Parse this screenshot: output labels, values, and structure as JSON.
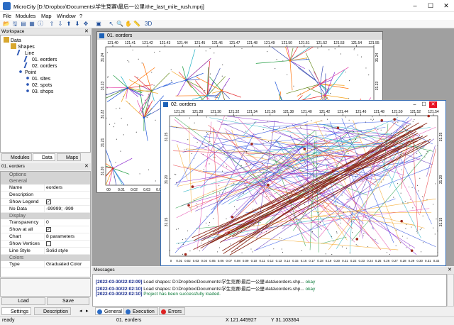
{
  "window": {
    "title": "MicroCity [D:\\Dropbox\\Documents\\学生竞赛\\最后一公里\\the_last_mile_rush.mprj]",
    "controls": [
      "–",
      "☐",
      "✕"
    ]
  },
  "menu": [
    "File",
    "Modules",
    "Map",
    "Window",
    "?"
  ],
  "toolbar": [
    {
      "name": "open-icon",
      "glyph": "📂"
    },
    {
      "name": "save-icon",
      "glyph": "🖫"
    },
    {
      "name": "table-icon",
      "glyph": "▤"
    },
    {
      "name": "properties-icon",
      "glyph": "▦"
    },
    {
      "name": "info-icon",
      "glyph": "ⓘ"
    },
    {
      "name": "arrow-up-icon",
      "glyph": "⇧"
    },
    {
      "name": "arrow-down-icon",
      "glyph": "⇩"
    },
    {
      "name": "layer-up-icon",
      "glyph": "⬆"
    },
    {
      "name": "layer-down-icon",
      "glyph": "⬇"
    },
    {
      "name": "move-icon",
      "glyph": "✥"
    },
    {
      "name": "zoom-box-icon",
      "glyph": "▣"
    },
    {
      "name": "select-icon",
      "glyph": "↖"
    },
    {
      "name": "zoom-icon",
      "glyph": "🔍"
    },
    {
      "name": "pan-icon",
      "glyph": "✋"
    },
    {
      "name": "measure-icon",
      "glyph": "📏"
    },
    {
      "name": "3d-view-icon",
      "glyph": "3D"
    }
  ],
  "workspace": {
    "title": "Workspace",
    "tree": [
      {
        "label": "Data",
        "level": 0,
        "icon": "folder"
      },
      {
        "label": "Shapes",
        "level": 1,
        "icon": "folder"
      },
      {
        "label": "Line",
        "level": 2,
        "icon": "line"
      },
      {
        "label": "01. eorders",
        "level": 3,
        "icon": "line"
      },
      {
        "label": "02. oorders",
        "level": 3,
        "icon": "line"
      },
      {
        "label": "Point",
        "level": 2,
        "icon": "point"
      },
      {
        "label": "01. sites",
        "level": 3,
        "icon": "point"
      },
      {
        "label": "02. spots",
        "level": 3,
        "icon": "point"
      },
      {
        "label": "03. shops",
        "level": 3,
        "icon": "point"
      }
    ],
    "tabs": [
      "Modules",
      "Data",
      "Maps"
    ]
  },
  "options": {
    "title": "01. eorders",
    "sections": [
      {
        "label": "Options",
        "rows": []
      },
      {
        "label": "General",
        "rows": [
          {
            "k": "Name",
            "v": "eorders"
          },
          {
            "k": "Description",
            "v": ""
          },
          {
            "k": "Show Legend",
            "v": "",
            "check": true
          },
          {
            "k": "No Data",
            "v": "-99999; -999"
          }
        ]
      },
      {
        "label": "Display",
        "rows": [
          {
            "k": "Transparency",
            "v": "0"
          },
          {
            "k": "Show at all",
            "v": "",
            "check": true
          },
          {
            "k": "Chart",
            "v": "8 parameters"
          },
          {
            "k": "Show Vertices",
            "v": "",
            "check": false
          },
          {
            "k": "Line Style",
            "v": "Solid style"
          }
        ]
      },
      {
        "label": "Colors",
        "rows": [
          {
            "k": "Type",
            "v": "Graduated Color"
          }
        ]
      }
    ],
    "load_label": "Load",
    "save_label": "Save",
    "tabs": [
      "Settings",
      "Description"
    ]
  },
  "map1": {
    "title": "01. eorders",
    "x_ticks": [
      "121.40",
      "121.41",
      "121.42",
      "121.43",
      "121.44",
      "121.45",
      "121.46",
      "121.47",
      "121.48",
      "121.49",
      "121.50",
      "121.51",
      "121.52",
      "121.53",
      "121.54",
      "121.55"
    ],
    "y_ticks": [
      "31.20",
      "31.21",
      "31.22",
      "31.23",
      "31.24"
    ],
    "bottom_ticks": [
      "00",
      "0.01",
      "0.02",
      "0.03",
      "0.04"
    ]
  },
  "map2": {
    "title": "02. oorders",
    "x_ticks": [
      "121.26",
      "121.28",
      "121.30",
      "121.32",
      "121.34",
      "121.36",
      "121.38",
      "121.40",
      "121.42",
      "121.44",
      "121.46",
      "121.48",
      "121.50",
      "121.52",
      "121.54"
    ],
    "y_ticks": [
      "31.25",
      "31.20",
      "31.15"
    ],
    "bottom_ticks": [
      "0",
      "0.01",
      "0.02",
      "0.03",
      "0.04",
      "0.05",
      "0.06",
      "0.07",
      "0.08",
      "0.09",
      "0.10",
      "0.11",
      "0.12",
      "0.13",
      "0.14",
      "0.15",
      "0.16",
      "0.17",
      "0.18",
      "0.19",
      "0.20",
      "0.21",
      "0.22",
      "0.23",
      "0.24",
      "0.25",
      "0.26",
      "0.27",
      "0.28",
      "0.29",
      "0.30",
      "0.31",
      "0.32"
    ]
  },
  "messages": {
    "title": "Messages",
    "lines": [
      {
        "ts": "[2022-03-30/22:02:09]",
        "text": "Load shapes: D:\\Dropbox\\Documents\\学生竞赛\\最后一公里\\data\\eorders.shp...",
        "status": "okay"
      },
      {
        "ts": "[2022-03-30/22:02:10]",
        "text": "Load shapes: D:\\Dropbox\\Documents\\学生竞赛\\最后一公里\\data\\oorders.shp...",
        "status": "okay"
      },
      {
        "ts": "[2022-03-30/22:02:10]",
        "text": "Project has been successfully loaded.",
        "status": ""
      }
    ],
    "tabs": [
      "General",
      "Execution",
      "Errors"
    ]
  },
  "status": {
    "left": "ready",
    "layer": "01. eorders",
    "x": "X 121.445927",
    "y": "Y 31.103364"
  }
}
